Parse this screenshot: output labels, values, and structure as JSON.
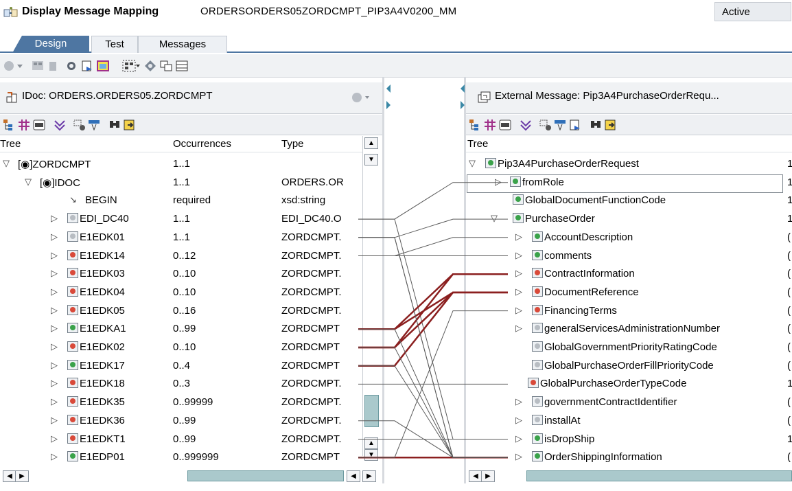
{
  "title": {
    "label": "Display Message Mapping",
    "name": "ORDERSORDERS05ZORDCMPT_PIP3A4V0200_MM",
    "status": "Active"
  },
  "tabs": [
    {
      "label": "Design",
      "active": true
    },
    {
      "label": "Test",
      "active": false
    },
    {
      "label": "Messages",
      "active": false
    }
  ],
  "left_panel": {
    "title": "IDoc: ORDERS.ORDERS05.ZORDCMPT",
    "columns": [
      "Tree",
      "Occurrences",
      "Type"
    ],
    "rows": [
      {
        "name": "[◉]ZORDCMPT",
        "occ": "1..1",
        "type": ""
      },
      {
        "name": "[◉]IDOC",
        "occ": "1..1",
        "type": "ORDERS.OR"
      },
      {
        "name": "BEGIN",
        "occ": "required",
        "type": "xsd:string"
      },
      {
        "name": "EDI_DC40",
        "occ": "1..1",
        "type": "EDI_DC40.O"
      },
      {
        "name": "E1EDK01",
        "occ": "1..1",
        "type": "ZORDCMPT."
      },
      {
        "name": "E1EDK14",
        "occ": "0..12",
        "type": "ZORDCMPT."
      },
      {
        "name": "E1EDK03",
        "occ": "0..10",
        "type": "ZORDCMPT."
      },
      {
        "name": "E1EDK04",
        "occ": "0..10",
        "type": "ZORDCMPT."
      },
      {
        "name": "E1EDK05",
        "occ": "0..16",
        "type": "ZORDCMPT."
      },
      {
        "name": "E1EDKA1",
        "occ": "0..99",
        "type": "ZORDCMPT"
      },
      {
        "name": "E1EDK02",
        "occ": "0..10",
        "type": "ZORDCMPT"
      },
      {
        "name": "E1EDK17",
        "occ": "0..4",
        "type": "ZORDCMPT"
      },
      {
        "name": "E1EDK18",
        "occ": "0..3",
        "type": "ZORDCMPT."
      },
      {
        "name": "E1EDK35",
        "occ": "0..99999",
        "type": "ZORDCMPT."
      },
      {
        "name": "E1EDK36",
        "occ": "0..99",
        "type": "ZORDCMPT."
      },
      {
        "name": "E1EDKT1",
        "occ": "0..99",
        "type": "ZORDCMPT."
      },
      {
        "name": "E1EDP01",
        "occ": "0..999999",
        "type": "ZORDCMPT"
      }
    ]
  },
  "right_panel": {
    "title": "External Message: Pip3A4PurchaseOrderRequ...",
    "columns": [
      "Tree"
    ],
    "rows": [
      {
        "name": "Pip3A4PurchaseOrderRequest",
        "occ": "1"
      },
      {
        "name": "fromRole",
        "occ": "1"
      },
      {
        "name": "GlobalDocumentFunctionCode",
        "occ": "1"
      },
      {
        "name": "PurchaseOrder",
        "occ": "1"
      },
      {
        "name": "AccountDescription",
        "occ": "("
      },
      {
        "name": "comments",
        "occ": "("
      },
      {
        "name": "ContractInformation",
        "occ": "("
      },
      {
        "name": "DocumentReference",
        "occ": "("
      },
      {
        "name": "FinancingTerms",
        "occ": "("
      },
      {
        "name": "generalServicesAdministrationNumber",
        "occ": "("
      },
      {
        "name": "GlobalGovernmentPriorityRatingCode",
        "occ": "("
      },
      {
        "name": "GlobalPurchaseOrderFillPriorityCode",
        "occ": "("
      },
      {
        "name": "GlobalPurchaseOrderTypeCode",
        "occ": "1"
      },
      {
        "name": "governmentContractIdentifier",
        "occ": "("
      },
      {
        "name": "installAt",
        "occ": "("
      },
      {
        "name": "isDropShip",
        "occ": "1"
      },
      {
        "name": "OrderShippingInformation",
        "occ": "("
      }
    ]
  },
  "colors": {
    "tab_active": "#4e76a2",
    "mapped_line": "#8b1f1f",
    "normal_line": "#5a5a5a"
  }
}
